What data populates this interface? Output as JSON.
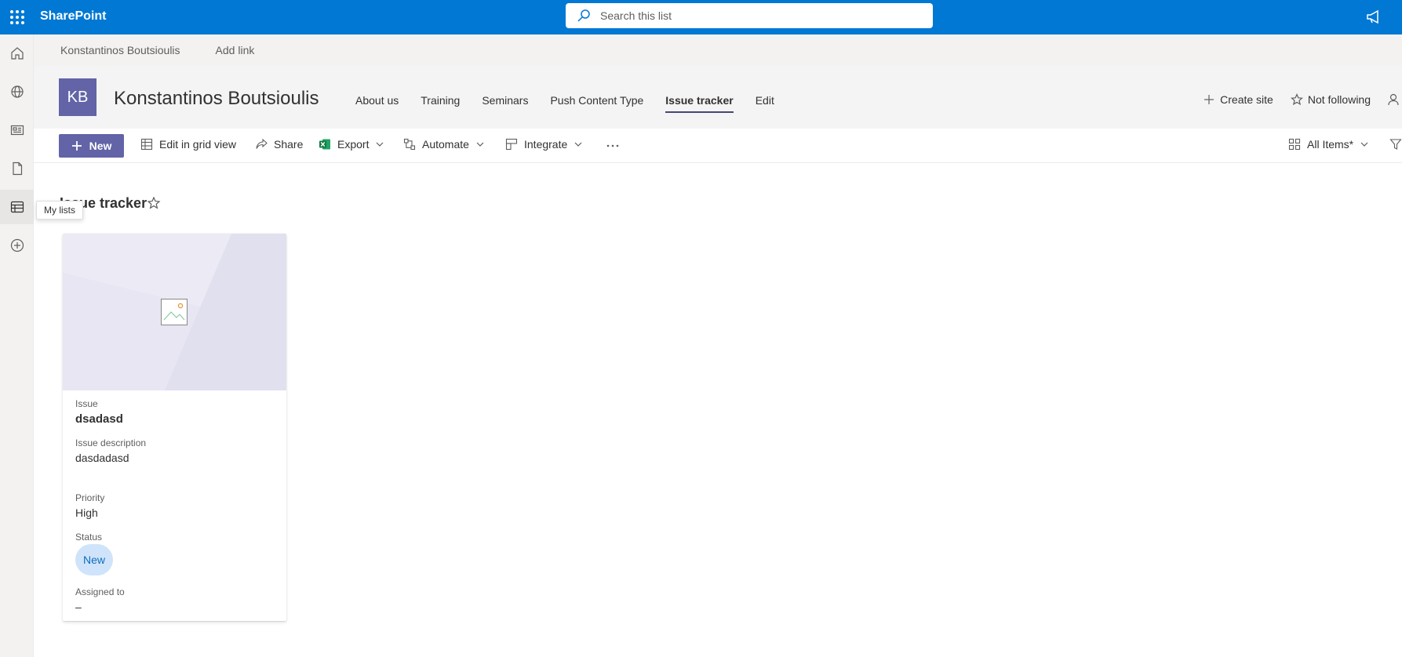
{
  "suite": {
    "brand": "SharePoint",
    "search_placeholder": "Search this list"
  },
  "rail": {
    "tooltip": "My lists"
  },
  "hub_nav": {
    "items": [
      "Konstantinos Boutsioulis",
      "Add link"
    ]
  },
  "site": {
    "logo_initials": "KB",
    "logo_color": "#6264a7",
    "title": "Konstantinos Boutsioulis",
    "nav": [
      "About us",
      "Training",
      "Seminars",
      "Push Content Type",
      "Issue tracker",
      "Edit"
    ],
    "active_nav": "Issue tracker",
    "actions": {
      "create_site": "Create site",
      "follow": "Not following"
    }
  },
  "command_bar": {
    "new_label": "New",
    "grid_view": "Edit in grid view",
    "share": "Share",
    "export": "Export",
    "automate": "Automate",
    "integrate": "Integrate",
    "view_name": "All Items*"
  },
  "list": {
    "title": "Issue tracker"
  },
  "card": {
    "fields": [
      {
        "label": "Issue",
        "value": "dsadasd"
      },
      {
        "label": "Issue description",
        "value": "dasdadasd"
      },
      {
        "label": "Priority",
        "value": "High"
      },
      {
        "label": "Status",
        "value": "New"
      },
      {
        "label": "Assigned to",
        "value": "–"
      }
    ]
  },
  "colors": {
    "suite_bar": "#0078d4",
    "accent": "#6264a7",
    "status_new_bg": "#cfe4fa",
    "status_new_text": "#0f6cbd"
  }
}
